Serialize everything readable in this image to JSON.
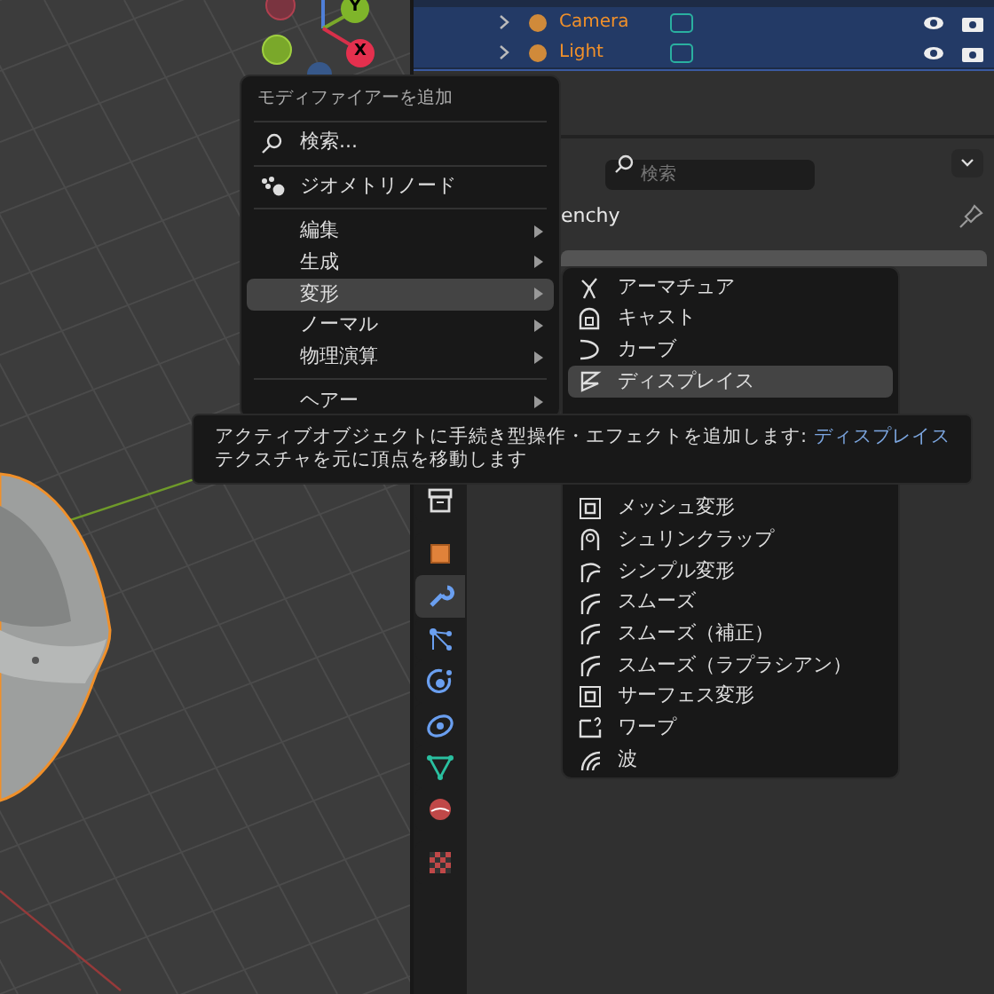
{
  "viewport": {
    "gizmo": {
      "axis_y": "Y",
      "axis_x": "X"
    }
  },
  "outliner": {
    "rows": [
      {
        "label": "Camera",
        "selected": true
      },
      {
        "label": "Light",
        "selected": true
      }
    ]
  },
  "properties": {
    "search": {
      "placeholder": "検索"
    },
    "object_name": "enchy",
    "tabs": [
      {
        "selected": false
      },
      {
        "selected": false
      },
      {
        "selected": true
      },
      {
        "selected": false
      },
      {
        "selected": false
      },
      {
        "selected": false
      },
      {
        "selected": false
      },
      {
        "selected": false
      },
      {
        "selected": false
      }
    ]
  },
  "add_modifier_menu": {
    "title": "モディファイアーを追加",
    "items": [
      {
        "kind": "separator"
      },
      {
        "kind": "search",
        "label": "検索..."
      },
      {
        "kind": "separator"
      },
      {
        "kind": "geometry",
        "label": "ジオメトリノード"
      },
      {
        "kind": "separator"
      },
      {
        "kind": "submenu",
        "label": "編集",
        "selected": false
      },
      {
        "kind": "submenu",
        "label": "生成",
        "selected": false
      },
      {
        "kind": "submenu",
        "label": "変形",
        "selected": true
      },
      {
        "kind": "submenu",
        "label": "ノーマル",
        "selected": false
      },
      {
        "kind": "submenu",
        "label": "物理演算",
        "selected": false
      },
      {
        "kind": "separator"
      },
      {
        "kind": "submenu",
        "label": "ヘアー",
        "selected": false
      }
    ]
  },
  "deform_submenu": {
    "upper_items": [
      {
        "label": "アーマチュア",
        "selected": false
      },
      {
        "label": "キャスト",
        "selected": false
      },
      {
        "label": "カーブ",
        "selected": false
      },
      {
        "label": "ディスプレイス",
        "selected": true
      }
    ],
    "lower_items": [
      {
        "label": "メッシュ変形",
        "selected": false
      },
      {
        "label": "シュリンクラップ",
        "selected": false
      },
      {
        "label": "シンプル変形",
        "selected": false
      },
      {
        "label": "スムーズ",
        "selected": false
      },
      {
        "label": "スムーズ（補正）",
        "selected": false
      },
      {
        "label": "スムーズ（ラプラシアン）",
        "selected": false
      },
      {
        "label": "サーフェス変形",
        "selected": false
      },
      {
        "label": "ワープ",
        "selected": false
      },
      {
        "label": "波",
        "selected": false
      }
    ]
  },
  "tooltip": {
    "text": "アクティブオブジェクトに手続き型操作・エフェクトを追加します:",
    "highlight": "ディスプレイス",
    "detail": "テクスチャを元に頂点を移動します"
  }
}
